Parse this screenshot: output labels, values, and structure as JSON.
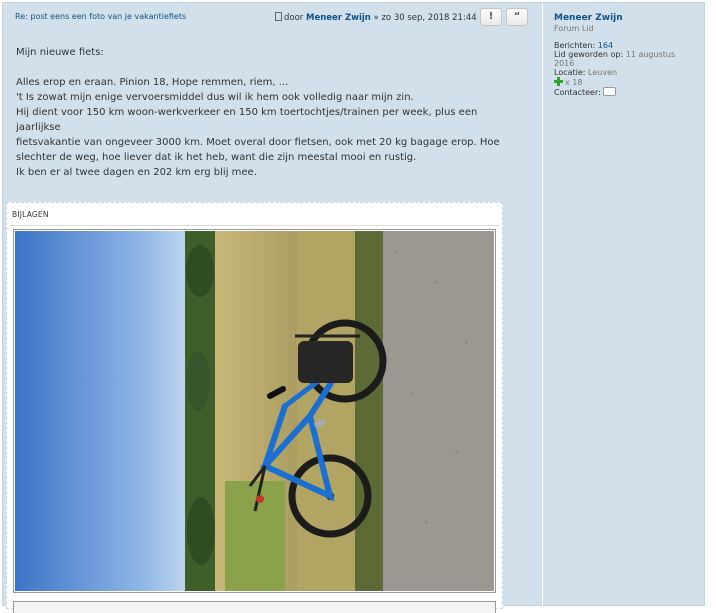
{
  "post": {
    "title": "Re: post eens een foto van je vakantiefiets",
    "author_prefix": "door",
    "author": "Meneer Zwijn",
    "date_text": "» zo 30 sep, 2018 21:44",
    "report_label": "!",
    "quote_label": "“"
  },
  "content": {
    "lines": [
      "Mijn nieuwe fiets:",
      "",
      "Alles erop en eraan. Pinion 18, Hope remmen, riem, ...",
      "'t Is zowat mijn enige vervoersmiddel dus wil ik hem ook volledig naar mijn zin.",
      "Hij dient voor 150 km woon-werkverkeer en 150 km toertochtjes/trainen per week, plus een jaarlijkse",
      "fietsvakantie van ongeveer 3000 km. Moet overal door fietsen, ook met 20 kg bagage erop. Hoe",
      "slechter de weg, hoe liever dat ik het heb, want die zijn meestal mooi en rustig.",
      "Ik ben er al twee dagen en 202 km erg blij mee."
    ]
  },
  "attachments": {
    "label": "BIJLAGEN"
  },
  "profile": {
    "username": "Meneer Zwijn",
    "rank": "Forum Lid",
    "posts_label": "Berichten:",
    "posts_value": "164",
    "joined_label": "Lid geworden op:",
    "joined_value_1": "11 augustus",
    "joined_value_2": "2016",
    "location_label": "Locatie:",
    "location_value": "Leuven",
    "reputation_value": "x 18",
    "contact_label": "Contacteer:"
  },
  "colors": {
    "post_bg": "#d1e0ea",
    "link": "#105289",
    "plus_green": "#2ea52e"
  }
}
